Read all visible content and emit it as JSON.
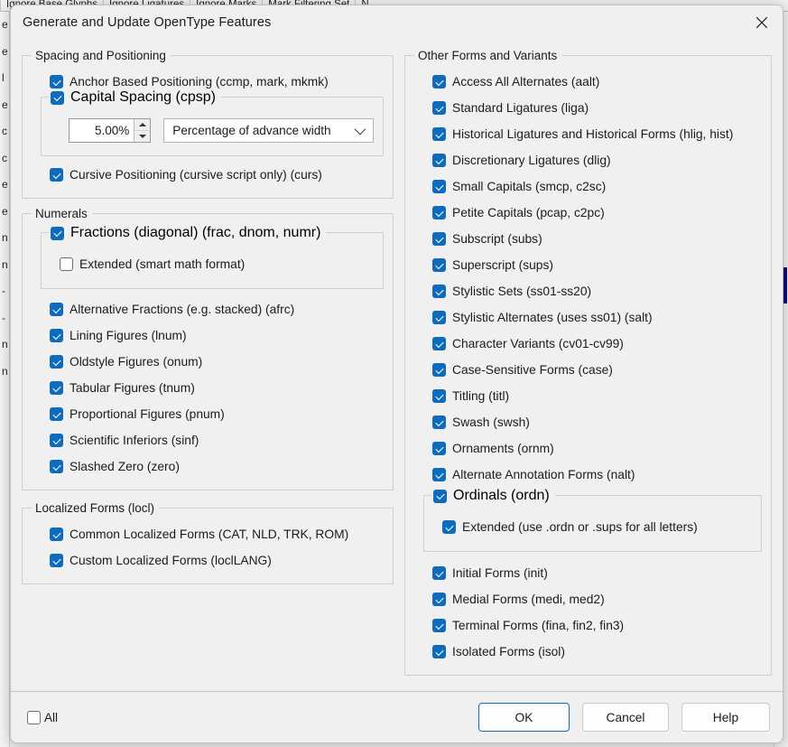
{
  "background": {
    "columns": [
      "Ignore Base Glyphs",
      "Ignore Ligatures",
      "Ignore Marks",
      "Mark Filtering Set",
      "N"
    ],
    "left_slivers": [
      "e",
      "e",
      "l",
      "e",
      "c",
      "c",
      "e",
      "e",
      "n",
      "n",
      "-",
      "-",
      "n",
      "n"
    ],
    "scroll_thumb_color": "#0a0a78"
  },
  "dialog": {
    "title": "Generate and Update OpenType Features",
    "close_icon": "close-icon",
    "accent": "#0f6cbd"
  },
  "left": {
    "spacing_group": {
      "title": "Spacing and Positioning",
      "anchor_based": {
        "label": "Anchor Based Positioning (ccmp, mark, mkmk)",
        "checked": true
      },
      "capital_spacing": {
        "label": "Capital Spacing (cpsp)",
        "checked": true
      },
      "spin_value": "5.00%",
      "combo_value": "Percentage of advance width",
      "cursive": {
        "label": "Cursive Positioning (cursive script only) (curs)",
        "checked": true
      }
    },
    "numerals_group": {
      "title": "Numerals",
      "fractions": {
        "label": "Fractions (diagonal) (frac, dnom, numr)",
        "checked": true
      },
      "fractions_extended": {
        "label": "Extended (smart math format)",
        "checked": false
      },
      "items": [
        {
          "label": "Alternative Fractions (e.g. stacked) (afrc)",
          "checked": true
        },
        {
          "label": "Lining Figures (lnum)",
          "checked": true
        },
        {
          "label": "Oldstyle Figures (onum)",
          "checked": true
        },
        {
          "label": "Tabular Figures (tnum)",
          "checked": true
        },
        {
          "label": "Proportional Figures (pnum)",
          "checked": true
        },
        {
          "label": "Scientific Inferiors (sinf)",
          "checked": true
        },
        {
          "label": "Slashed Zero (zero)",
          "checked": true
        }
      ]
    },
    "localized_group": {
      "title": "Localized Forms (locl)",
      "items": [
        {
          "label": "Common Localized Forms (CAT, NLD, TRK, ROM)",
          "checked": true
        },
        {
          "label": "Custom Localized Forms (loclLANG)",
          "checked": true
        }
      ]
    }
  },
  "right": {
    "other_group": {
      "title": "Other Forms and Variants",
      "items_top": [
        {
          "label": "Access All Alternates (aalt)",
          "checked": true
        },
        {
          "label": "Standard Ligatures (liga)",
          "checked": true
        },
        {
          "label": "Historical Ligatures and Historical Forms (hlig, hist)",
          "checked": true
        },
        {
          "label": "Discretionary Ligatures (dlig)",
          "checked": true
        },
        {
          "label": "Small Capitals (smcp, c2sc)",
          "checked": true
        },
        {
          "label": "Petite Capitals (pcap, c2pc)",
          "checked": true
        },
        {
          "label": "Subscript (subs)",
          "checked": true
        },
        {
          "label": "Superscript (sups)",
          "checked": true
        },
        {
          "label": "Stylistic Sets (ss01-ss20)",
          "checked": true
        },
        {
          "label": "Stylistic Alternates (uses ss01) (salt)",
          "checked": true
        },
        {
          "label": "Character Variants (cv01-cv99)",
          "checked": true
        },
        {
          "label": "Case-Sensitive Forms (case)",
          "checked": true
        },
        {
          "label": "Titling (titl)",
          "checked": true
        },
        {
          "label": "Swash (swsh)",
          "checked": true
        },
        {
          "label": "Ornaments (ornm)",
          "checked": true
        },
        {
          "label": "Alternate Annotation Forms (nalt)",
          "checked": true
        }
      ],
      "ordinals": {
        "label": "Ordinals (ordn)",
        "checked": true
      },
      "ordinals_extended": {
        "label": "Extended (use .ordn or .sups for all letters)",
        "checked": true
      },
      "items_bottom": [
        {
          "label": "Initial Forms (init)",
          "checked": true
        },
        {
          "label": "Medial Forms (medi, med2)",
          "checked": true
        },
        {
          "label": "Terminal Forms (fina, fin2, fin3)",
          "checked": true
        },
        {
          "label": "Isolated Forms (isol)",
          "checked": true
        }
      ]
    }
  },
  "footer": {
    "all": {
      "label": "All",
      "checked": false
    },
    "ok_label": "OK",
    "cancel_label": "Cancel",
    "help_label": "Help"
  }
}
